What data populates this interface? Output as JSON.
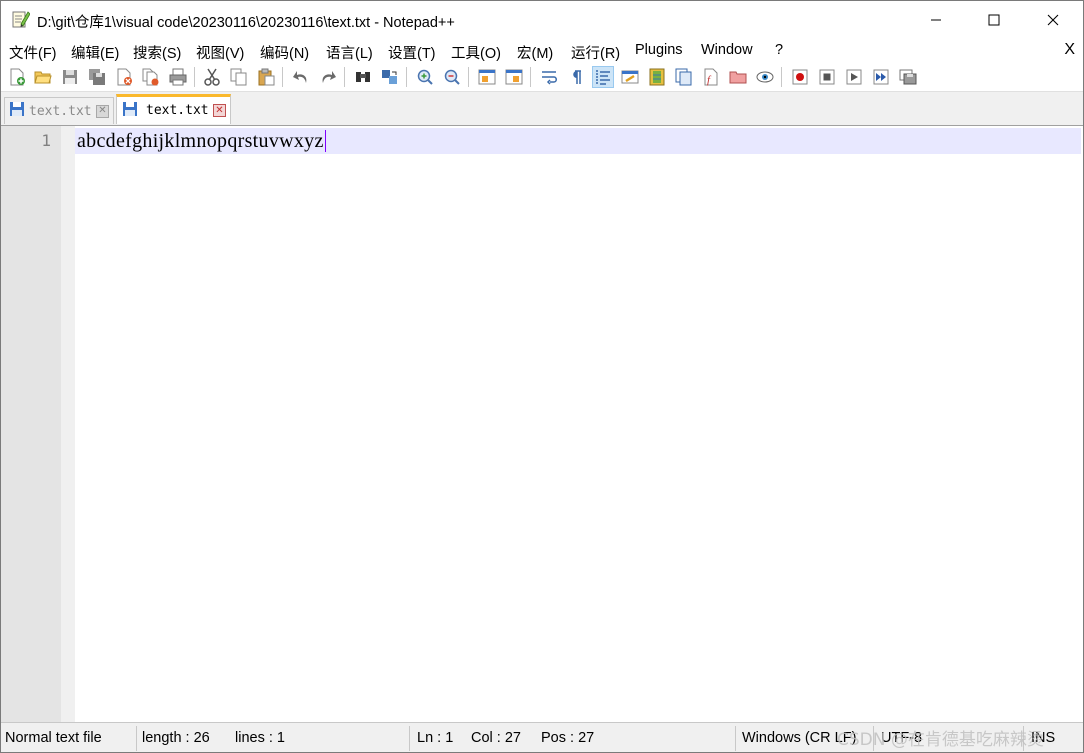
{
  "window": {
    "title": "D:\\git\\仓库1\\visual code\\20230116\\20230116\\text.txt - Notepad++",
    "minimize_icon": "minimize-icon",
    "maximize_icon": "maximize-icon",
    "close_icon": "close-icon"
  },
  "menu": {
    "items": [
      "文件(F)",
      "编辑(E)",
      "搜索(S)",
      "视图(V)",
      "编码(N)",
      "语言(L)",
      "设置(T)",
      "工具(O)",
      "宏(M)",
      "运行(R)",
      "Plugins",
      "Window",
      "?"
    ],
    "close_doc": "X"
  },
  "toolbar": {
    "icons": [
      "new-file-icon",
      "open-file-icon",
      "save-icon",
      "save-all-icon",
      "close-icon",
      "close-all-icon",
      "print-icon",
      "cut-icon",
      "copy-icon",
      "paste-icon",
      "undo-icon",
      "redo-icon",
      "find-icon",
      "replace-icon",
      "zoom-in-icon",
      "zoom-out-icon",
      "sync-vertical-icon",
      "sync-horizontal-icon",
      "word-wrap-icon",
      "show-all-chars-icon",
      "indent-guide-icon",
      "udl-icon",
      "doc-map-icon",
      "doc-list-icon",
      "function-list-icon",
      "folder-workspace-icon",
      "monitoring-icon",
      "record-macro-icon",
      "stop-macro-icon",
      "play-macro-icon",
      "run-macro-multiple-icon",
      "save-macro-icon"
    ]
  },
  "tabs": [
    {
      "label": "text.txt",
      "active": false
    },
    {
      "label": "text.txt",
      "active": true
    }
  ],
  "editor": {
    "line_number": "1",
    "content": "abcdefghijklmnopqrstuvwxyz"
  },
  "status": {
    "file_type": "Normal text file",
    "length": "length : 26",
    "lines": "lines : 1",
    "ln": "Ln : 1",
    "col": "Col : 27",
    "pos": "Pos : 27",
    "eol": "Windows (CR LF)",
    "encoding": "UTF-8",
    "mode": "INS"
  },
  "watermark": "CSDN @在肯德基吃麻辣烫",
  "colors": {
    "current_line": "#e8e8ff",
    "active_tab_accent": "#fab82c",
    "caret": "#8000ff"
  }
}
